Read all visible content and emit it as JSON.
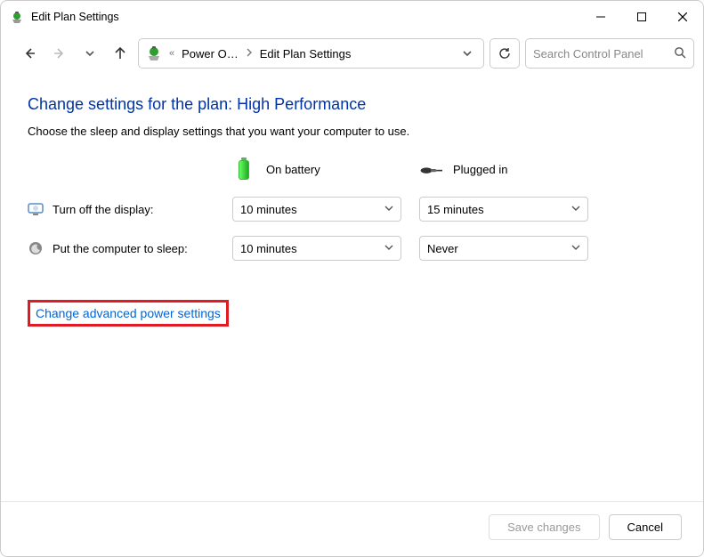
{
  "window": {
    "title": "Edit Plan Settings"
  },
  "breadcrumb": {
    "prefix": "«",
    "items": [
      "Power O…",
      "Edit Plan Settings"
    ]
  },
  "search": {
    "placeholder": "Search Control Panel"
  },
  "page": {
    "title": "Change settings for the plan: High Performance",
    "subtitle": "Choose the sleep and display settings that you want your computer to use."
  },
  "columns": {
    "battery": "On battery",
    "plugged": "Plugged in"
  },
  "rows": {
    "display": {
      "label": "Turn off the display:",
      "battery": "10 minutes",
      "plugged": "15 minutes"
    },
    "sleep": {
      "label": "Put the computer to sleep:",
      "battery": "10 minutes",
      "plugged": "Never"
    }
  },
  "links": {
    "advanced": "Change advanced power settings"
  },
  "buttons": {
    "save": "Save changes",
    "cancel": "Cancel"
  }
}
